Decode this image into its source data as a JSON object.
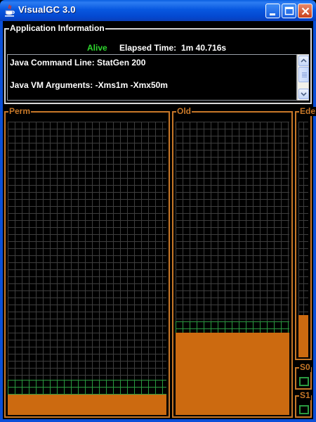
{
  "window": {
    "title": "VisualGC 3.0"
  },
  "app_info": {
    "group_title": "Application Information",
    "status": "Alive",
    "elapsed_label": "Elapsed Time:",
    "elapsed_value": "1m 40.716s",
    "command_line": "Java Command Line: StatGen 200",
    "vm_arguments": "Java VM Arguments: -Xms1m -Xmx50m"
  },
  "spaces": {
    "perm": {
      "label": "Perm",
      "used_fraction": 0.07,
      "committed_fraction": 0.12
    },
    "old": {
      "label": "Old",
      "used_fraction": 0.28,
      "committed_fraction": 0.32
    },
    "eden": {
      "label": "Ede",
      "used_fraction": 0.18,
      "committed_fraction": 1.0
    },
    "s0": {
      "label": "S0",
      "used_fraction": 0.0
    },
    "s1": {
      "label": "S1",
      "used_fraction": 0.0
    }
  },
  "colors": {
    "accent": "#c87828",
    "used_fill": "#cc6a10",
    "committed_grid": "#2a9a40",
    "status_alive": "#2ed82e"
  }
}
